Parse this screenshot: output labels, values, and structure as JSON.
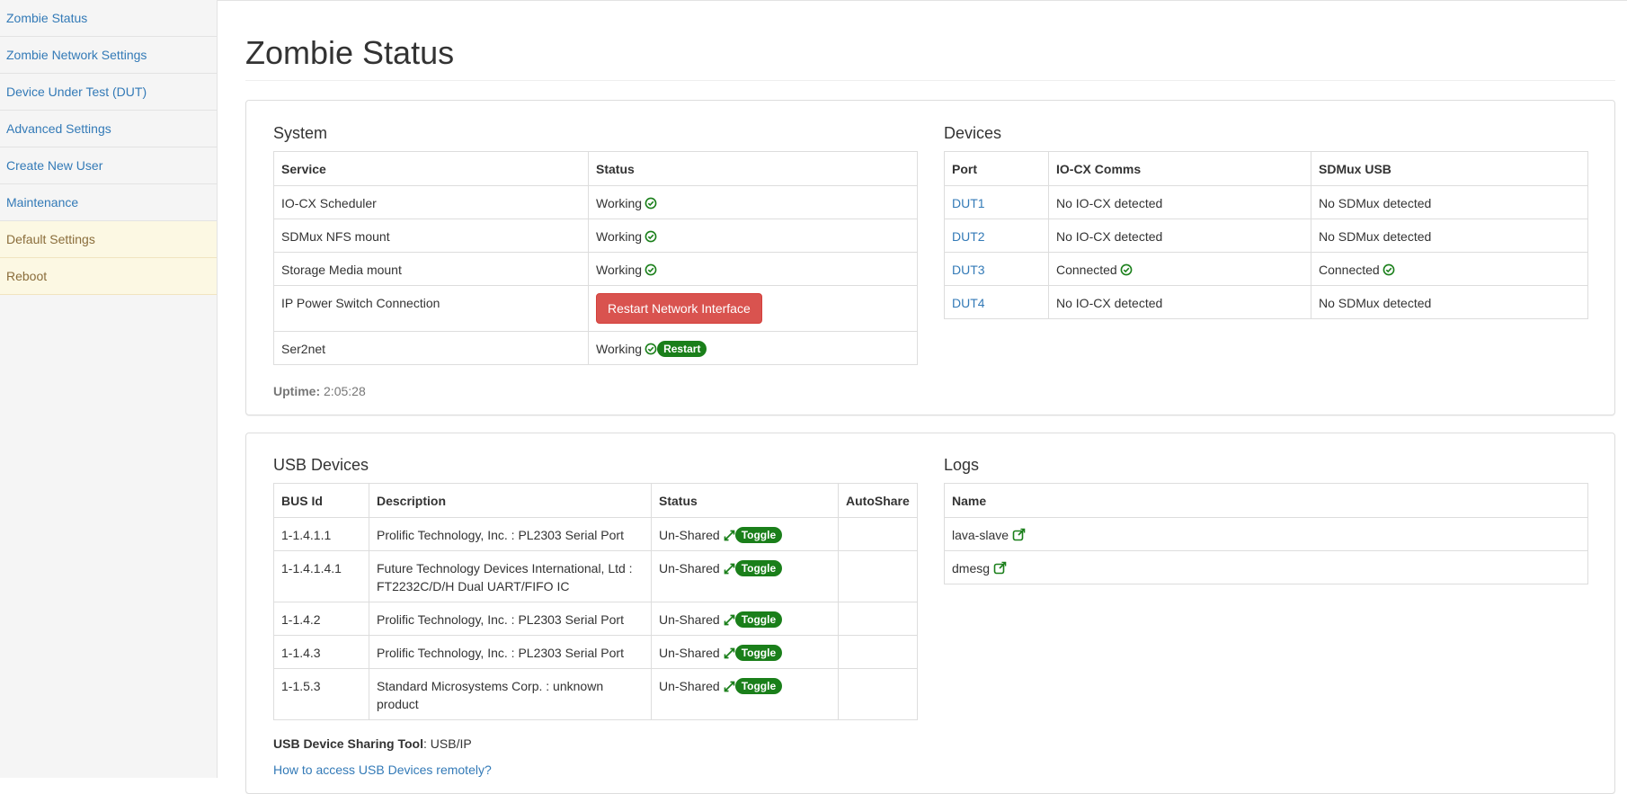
{
  "sidebar": {
    "items": [
      {
        "label": "Zombie Status"
      },
      {
        "label": "Zombie Network Settings"
      },
      {
        "label": "Device Under Test (DUT)"
      },
      {
        "label": "Advanced Settings"
      },
      {
        "label": "Create New User"
      },
      {
        "label": "Maintenance"
      },
      {
        "label": "Default Settings"
      },
      {
        "label": "Reboot"
      }
    ]
  },
  "page": {
    "title": "Zombie Status"
  },
  "system": {
    "title": "System",
    "headers": [
      "Service",
      "Status"
    ],
    "rows": [
      {
        "service": "IO-CX Scheduler",
        "status": "Working"
      },
      {
        "service": "SDMux NFS mount",
        "status": "Working"
      },
      {
        "service": "Storage Media mount",
        "status": "Working"
      },
      {
        "service": "IP Power Switch Connection",
        "button": "Restart Network Interface"
      },
      {
        "service": "Ser2net",
        "status": "Working",
        "badge": "Restart"
      }
    ],
    "uptime_label": "Uptime:",
    "uptime_value": "2:05:28"
  },
  "devices": {
    "title": "Devices",
    "headers": [
      "Port",
      "IO-CX Comms",
      "SDMux USB"
    ],
    "rows": [
      {
        "port": "DUT1",
        "iocx": "No IO-CX detected",
        "sdmux": "No SDMux detected"
      },
      {
        "port": "DUT2",
        "iocx": "No IO-CX detected",
        "sdmux": "No SDMux detected"
      },
      {
        "port": "DUT3",
        "iocx": "Connected",
        "sdmux": "Connected"
      },
      {
        "port": "DUT4",
        "iocx": "No IO-CX detected",
        "sdmux": "No SDMux detected"
      }
    ]
  },
  "usb": {
    "title": "USB Devices",
    "headers": [
      "BUS Id",
      "Description",
      "Status",
      "AutoShare"
    ],
    "rows": [
      {
        "bus": "1-1.4.1.1",
        "desc": "Prolific Technology, Inc. : PL2303 Serial Port",
        "status": "Un-Shared",
        "toggle": "Toggle"
      },
      {
        "bus": "1-1.4.1.4.1",
        "desc": "Future Technology Devices International, Ltd : FT2232C/D/H Dual UART/FIFO IC",
        "status": "Un-Shared",
        "toggle": "Toggle"
      },
      {
        "bus": "1-1.4.2",
        "desc": "Prolific Technology, Inc. : PL2303 Serial Port",
        "status": "Un-Shared",
        "toggle": "Toggle"
      },
      {
        "bus": "1-1.4.3",
        "desc": "Prolific Technology, Inc. : PL2303 Serial Port",
        "status": "Un-Shared",
        "toggle": "Toggle"
      },
      {
        "bus": "1-1.5.3",
        "desc": "Standard Microsystems Corp. : unknown product",
        "status": "Un-Shared",
        "toggle": "Toggle"
      }
    ],
    "tool_label": "USB Device Sharing Tool",
    "tool_value": ": USB/IP",
    "help_link": "How to access USB Devices remotely?"
  },
  "logs": {
    "title": "Logs",
    "headers": [
      "Name"
    ],
    "rows": [
      {
        "name": "lava-slave"
      },
      {
        "name": "dmesg"
      }
    ]
  },
  "colors": {
    "link": "#337ab7",
    "ok": "#1a7f1a",
    "danger": "#d9534f",
    "warn_bg": "#fcf8e3"
  }
}
